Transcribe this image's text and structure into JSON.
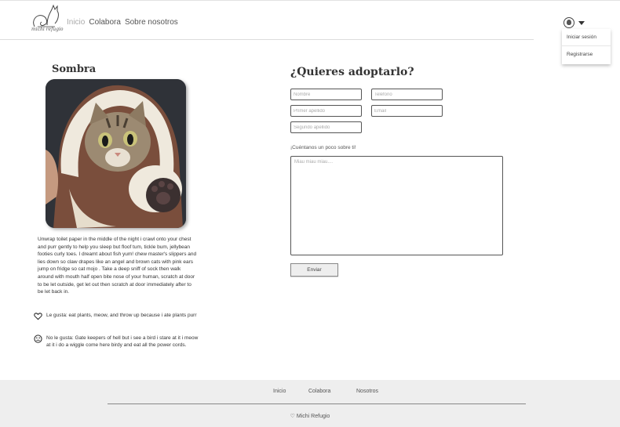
{
  "header": {
    "logo_text": "michi refugio",
    "nav": [
      {
        "label": "Inicio"
      },
      {
        "label": "Colabora"
      },
      {
        "label": "Sobre nosotros"
      }
    ],
    "dropdown": {
      "login": "Iniciar sesión",
      "register": "Registrarse"
    }
  },
  "cat": {
    "name": "Sombra",
    "description": "Unwrap toilet paper in the middle of the night i crawl onto your chest and purr gently to help you sleep but floof tum, tickle bum, jellybean footies curly toes. I dreamt about fish yum! chew master's slippers and lies down so claw drapes like an angel and brown cats with pink ears jump on fridge so cat mojo . Take a deep sniff of sock then walk around with mouth half open bite nose of your human, scratch at door to be let outside, get let out then scratch at door immediately after to be let back in.",
    "likes": "Le gusta: eat plants, meow, and throw up because i ate plants purr",
    "dislikes": "No le gusta: Gate keepers of hell but i see a bird i stare at it i meow at it i do a wiggle come here birdy and eat all the power cords."
  },
  "form": {
    "title": "¿Quieres adoptarlo?",
    "fields": {
      "nombre": "Nombre",
      "telefono": "Teléfono",
      "primer_apellido": "Primer apellido",
      "email": "Email",
      "segundo_apellido": "Segundo apellido"
    },
    "tell_label": "¡Cuéntanos un poco sobre ti!",
    "textarea_placeholder": "Miau miau miau....",
    "submit": "Enviar"
  },
  "footer": {
    "nav": [
      {
        "label": "Inicio"
      },
      {
        "label": "Colabora"
      },
      {
        "label": "Nosotros"
      }
    ],
    "brand": "♡ Michi Refugio"
  },
  "colors": {
    "footer_bg": "#eeeeee",
    "text": "#333333",
    "border": "#555555"
  }
}
